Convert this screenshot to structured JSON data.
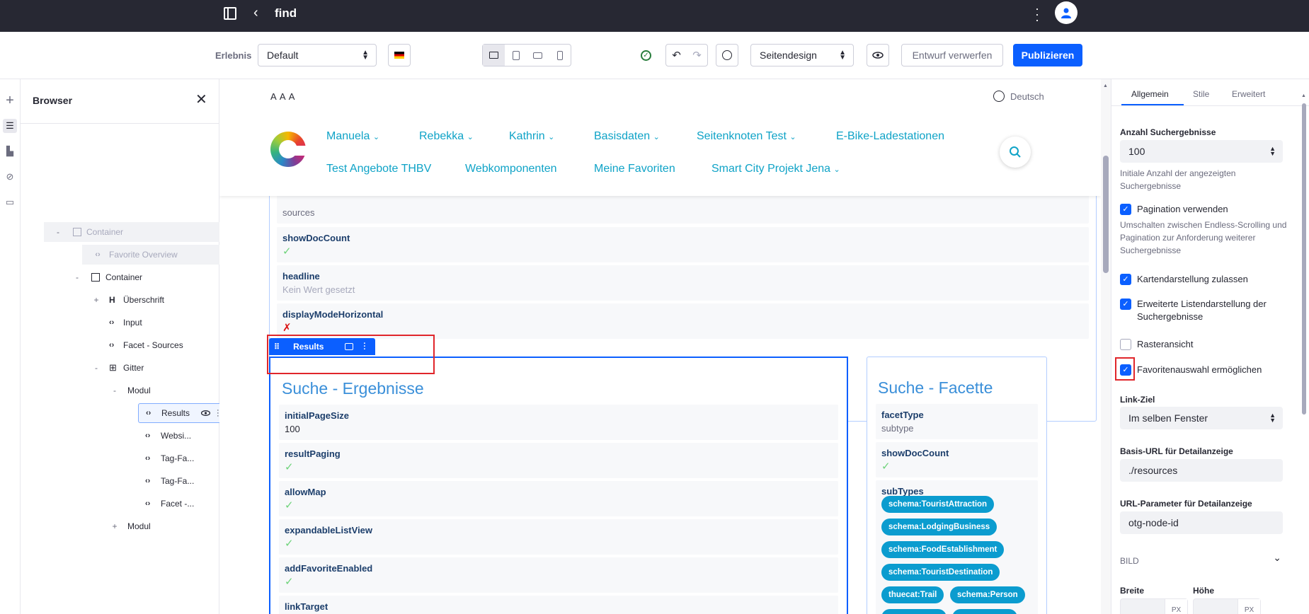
{
  "topbar": {
    "title": "find"
  },
  "toolbar": {
    "experience_label": "Erlebnis",
    "experience_value": "Default",
    "page_design_value": "Seitendesign",
    "discard_label": "Entwurf verwerfen",
    "publish_label": "Publizieren"
  },
  "browser": {
    "title": "Browser",
    "items": [
      {
        "label": "Container",
        "toggle": "-"
      },
      {
        "label": "Favorite Overview",
        "toggle": ""
      },
      {
        "label": "Container",
        "toggle": "-"
      },
      {
        "label": "Überschrift",
        "toggle": "+"
      },
      {
        "label": "Input",
        "toggle": ""
      },
      {
        "label": "Facet - Sources",
        "toggle": ""
      },
      {
        "label": "Gitter",
        "toggle": "-"
      },
      {
        "label": "Modul",
        "toggle": "-"
      },
      {
        "label": "Results",
        "toggle": ""
      },
      {
        "label": "Websi...",
        "toggle": ""
      },
      {
        "label": "Tag-Fa...",
        "toggle": ""
      },
      {
        "label": "Tag-Fa...",
        "toggle": ""
      },
      {
        "label": "Facet -...",
        "toggle": ""
      },
      {
        "label": "Modul",
        "toggle": "+"
      }
    ]
  },
  "site": {
    "font_sizes": "A A A",
    "language": "Deutsch",
    "nav_row1": [
      "Manuela",
      "Rebekka",
      "Kathrin",
      "Basisdaten",
      "Seitenknoten Test",
      "E-Bike-Ladestationen"
    ],
    "nav_row2": [
      "Test Angebote THBV",
      "Webkomponenten",
      "Meine Favoriten",
      "Smart City Projekt Jena"
    ]
  },
  "top_fragment": {
    "props": [
      {
        "key": "",
        "value": "sources"
      },
      {
        "key": "showDocCount",
        "value": "✓"
      },
      {
        "key": "headline",
        "value": "Kein Wert gesetzt"
      },
      {
        "key": "displayModeHorizontal",
        "value": "✗"
      }
    ]
  },
  "results_topper": {
    "label": "Results"
  },
  "results": {
    "title": "Suche - Ergebnisse",
    "props": [
      {
        "key": "initialPageSize",
        "value": "100"
      },
      {
        "key": "resultPaging",
        "value": "✓"
      },
      {
        "key": "allowMap",
        "value": "✓"
      },
      {
        "key": "expandableListView",
        "value": "✓"
      },
      {
        "key": "addFavoriteEnabled",
        "value": "✓"
      },
      {
        "key": "linkTarget",
        "value": ""
      }
    ]
  },
  "facette": {
    "title": "Suche - Facette",
    "props": [
      {
        "key": "facetType",
        "value": "subtype"
      },
      {
        "key": "showDocCount",
        "value": "✓"
      },
      {
        "key": "subTypes",
        "value": ""
      }
    ],
    "chips": [
      "schema:TouristAttraction",
      "schema:LodgingBusiness",
      "schema:FoodEstablishment",
      "schema:TouristDestination",
      "thuecat:Trail",
      "schema:Person"
    ]
  },
  "panel": {
    "tabs": [
      "Allgemein",
      "Stile",
      "Erweitert"
    ],
    "result_count_label": "Anzahl Suchergebnisse",
    "result_count_value": "100",
    "result_count_help": "Initiale Anzahl der angezeigten Suchergebnisse",
    "pagination_label": "Pagination verwenden",
    "pagination_help": "Umschalten zwischen Endless-Scrolling und Pagination zur Anforderung weiterer Suchergebnisse",
    "map_label": "Kartendarstellung zulassen",
    "extended_list_label": "Erweiterte Listendarstellung der Suchergebnisse",
    "grid_label": "Rasteransicht",
    "favorites_label": "Favoritenauswahl ermöglichen",
    "link_target_label": "Link-Ziel",
    "link_target_value": "Im selben Fenster",
    "base_url_label": "Basis-URL für Detailanzeige",
    "base_url_value": "./resources",
    "url_param_label": "URL-Parameter für Detailanzeige",
    "url_param_value": "otg-node-id",
    "image_section": "BILD",
    "width_label": "Breite",
    "height_label": "Höhe",
    "unit": "PX"
  },
  "colors": {
    "accent": "#0b5fff",
    "nav": "#0fa3c7",
    "chip": "#0b9ccf",
    "highlight": "#e0262b"
  }
}
